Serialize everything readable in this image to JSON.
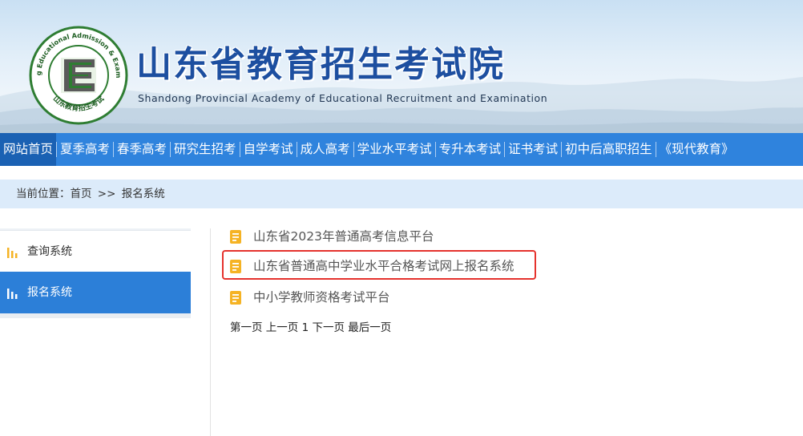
{
  "header": {
    "logo": {
      "ring_text": "Shandong Educational Admission & Examinations",
      "bottom_text": "山东教育招生考试",
      "letter": "E"
    },
    "title": "山东省教育招生考试院",
    "subtitle": "Shandong Provincial Academy of Educational Recruitment and Examination"
  },
  "nav": {
    "items": [
      {
        "label": "网站首页",
        "active": true
      },
      {
        "label": "夏季高考"
      },
      {
        "label": "春季高考"
      },
      {
        "label": "研究生招考"
      },
      {
        "label": "自学考试"
      },
      {
        "label": "成人高考"
      },
      {
        "label": "学业水平考试"
      },
      {
        "label": "专升本考试"
      },
      {
        "label": "证书考试"
      },
      {
        "label": "初中后高职招生"
      },
      {
        "label": "《现代教育》"
      }
    ]
  },
  "breadcrumb": {
    "prefix": "当前位置：",
    "home": "首页",
    "separator": ">>",
    "current": "报名系统"
  },
  "sidebar": {
    "items": [
      {
        "label": "查询系统",
        "icon": "bar-chart-icon",
        "active": false
      },
      {
        "label": "报名系统",
        "icon": "bar-chart-icon",
        "active": true
      }
    ]
  },
  "content": {
    "links": [
      {
        "label": "山东省2023年普通高考信息平台",
        "icon": "document-icon"
      },
      {
        "label": "山东省普通高中学业水平合格考试网上报名系统",
        "icon": "document-icon",
        "highlighted": true
      },
      {
        "label": "中小学教师资格考试平台",
        "icon": "document-icon"
      }
    ],
    "pager": {
      "first": "第一页",
      "prev": "上一页",
      "current": "1",
      "next": "下一页",
      "last": "最后一页"
    }
  },
  "colors": {
    "nav_bg": "#2f83dd",
    "nav_active": "#1a61b3",
    "title_blue": "#1d4fa0",
    "breadcrumb_bg": "#dcebfa",
    "sidebar_active": "#2c7fd8",
    "icon_yellow": "#f5b324",
    "highlight_red": "#e5322d",
    "logo_green": "#2e7d32"
  }
}
